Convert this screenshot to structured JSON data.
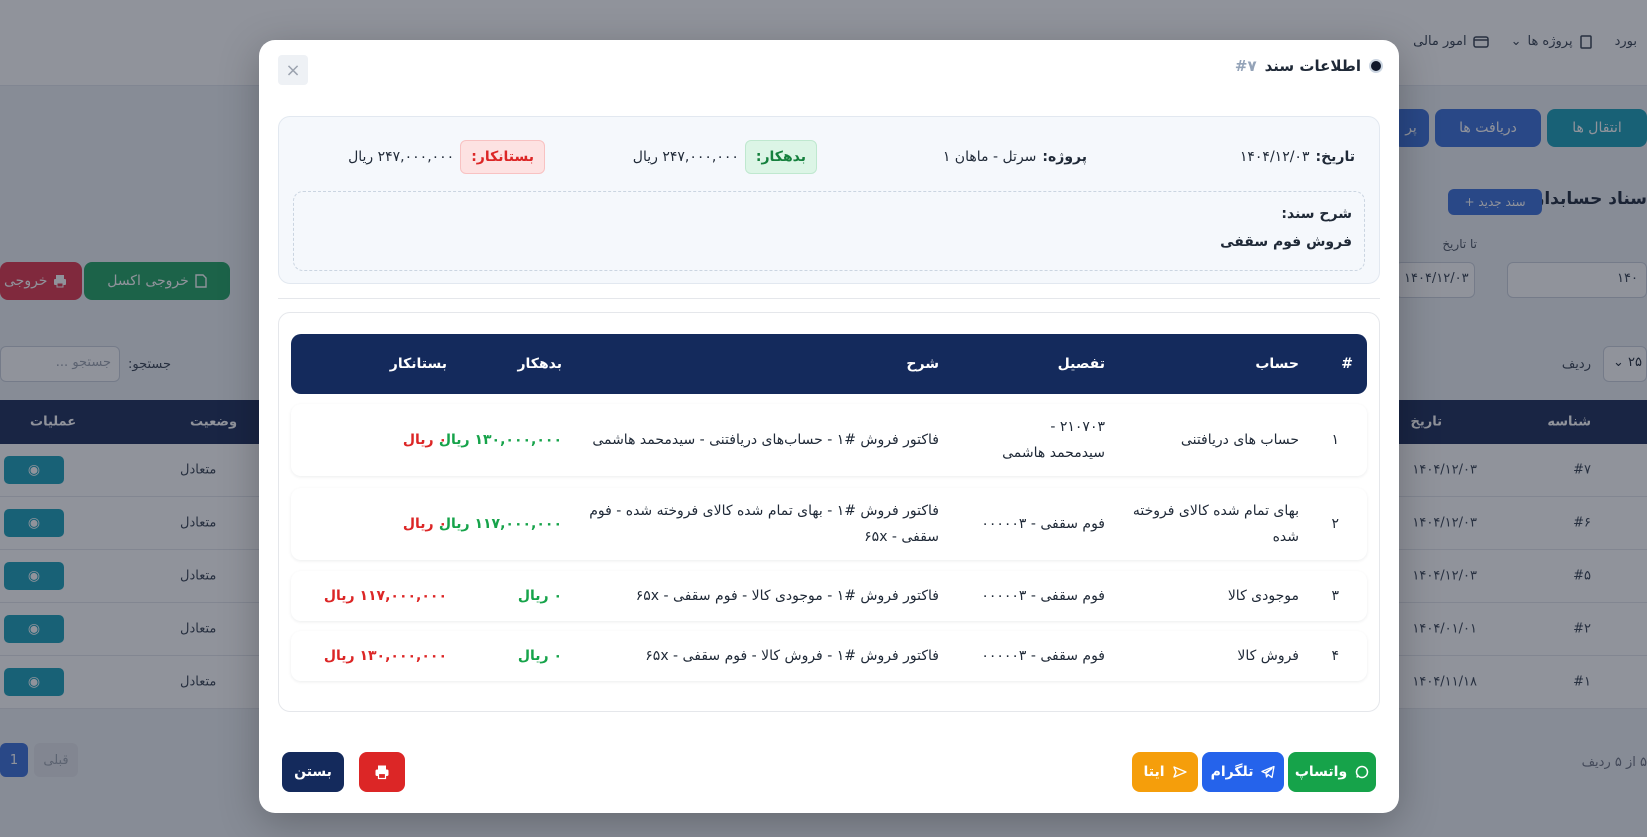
{
  "background": {
    "nav_items": [
      "بورد",
      "پروژه ها",
      "امور مالی"
    ],
    "tabs": [
      "انتقال ها",
      "دریافت ها",
      "پر"
    ],
    "page_title": "سناد حسابداری",
    "new_doc_label": "سند جدید +",
    "to_date_label": "تا تاریخ",
    "date_from_value": "۱۴۰",
    "date_to_value": "۱۴۰۴/۱۲/۰۳",
    "excel_label": "خروجی اکسل",
    "export_label": "خروجی",
    "search_label": "جستجو:",
    "search_placeholder": "جستجو ...",
    "rows_label": "ردیف",
    "rows_value": "۲۵",
    "table_headers": {
      "id": "شناسه",
      "date": "تاریخ",
      "status": "وضعیت",
      "ops": "عملیات"
    },
    "rows": [
      {
        "id": "#۷",
        "date": "۱۴۰۴/۱۲/۰۳",
        "status": "متعادل"
      },
      {
        "id": "#۶",
        "date": "۱۴۰۴/۱۲/۰۳",
        "status": "متعادل"
      },
      {
        "id": "#۵",
        "date": "۱۴۰۴/۱۲/۰۳",
        "status": "متعادل"
      },
      {
        "id": "#۲",
        "date": "۱۴۰۴/۰۱/۰۱",
        "status": "متعادل"
      },
      {
        "id": "#۱",
        "date": "۱۴۰۴/۱۱/۱۸",
        "status": "متعادل"
      }
    ],
    "pager": {
      "prev": "قبلی",
      "current": "1"
    },
    "footer_info": "۵ از ۵ ردیف"
  },
  "modal": {
    "title": "اطلاعات سند",
    "doc_number": "#۷",
    "close_symbol": "×",
    "info": {
      "date_key": "تاریخ:",
      "date_value": "۱۴۰۴/۱۲/۰۳",
      "project_key": "پروژه:",
      "project_value": "سرتل - ماهان ۱",
      "debit_key": "بدهکار:",
      "debit_value": "۲۴۷,۰۰۰,۰۰۰ ریال",
      "credit_key": "بستانکار:",
      "credit_value": "۲۴۷,۰۰۰,۰۰۰ ریال"
    },
    "description_key": "شرح سند:",
    "description_value": "فروش فوم سقفی",
    "table_headers": {
      "num": "#",
      "account": "حساب",
      "detail": "تفصیل",
      "desc": "شرح",
      "debit": "بدهکار",
      "credit": "بستانکار"
    },
    "rows": [
      {
        "num": "۱",
        "account": "حساب های دریافتنی",
        "detail": "۲۱۰۷۰۳ - سیدمحمد هاشمی",
        "desc": "فاکتور فروش #۱ - حساب‌های دریافتنی - سیدمحمد هاشمی",
        "debit": "۱۳۰,۰۰۰,۰۰۰ ریال",
        "credit": "۰ ریال"
      },
      {
        "num": "۲",
        "account": "بهای تمام شده کالای فروخته شده",
        "detail": "فوم سقفی - ۰۰۰۰۰۳",
        "desc": "فاکتور فروش #۱ - بهای تمام شده کالای فروخته شده - فوم سقفی - ۶۵x",
        "debit": "۱۱۷,۰۰۰,۰۰۰ ریال",
        "credit": "۰ ریال"
      },
      {
        "num": "۳",
        "account": "موجودی کالا",
        "detail": "فوم سقفی - ۰۰۰۰۰۳",
        "desc": "فاکتور فروش #۱ - موجودی کالا - فوم سقفی - ۶۵x",
        "debit": "۰ ریال",
        "credit": "۱۱۷,۰۰۰,۰۰۰ ریال"
      },
      {
        "num": "۴",
        "account": "فروش کالا",
        "detail": "فوم سقفی - ۰۰۰۰۰۳",
        "desc": "فاکتور فروش #۱ - فروش کالا - فوم سقفی - ۶۵x",
        "debit": "۰ ریال",
        "credit": "۱۳۰,۰۰۰,۰۰۰ ریال"
      }
    ],
    "buttons": {
      "whatsapp": "واتساپ",
      "telegram": "تلگرام",
      "eitaa": "ایتا",
      "close": "بستن"
    }
  },
  "colors": {
    "header_navy": "#142a5c",
    "green": "#16a34a",
    "red": "#dc2626",
    "blue": "#2563eb",
    "amber": "#f59e0b",
    "teal": "#1aa0b9"
  },
  "icons": [
    "close-icon",
    "whatsapp-icon",
    "telegram-icon",
    "eitaa-icon",
    "printer-icon",
    "eye-icon",
    "excel-icon",
    "project-icon",
    "card-icon",
    "chevron-down-icon"
  ]
}
